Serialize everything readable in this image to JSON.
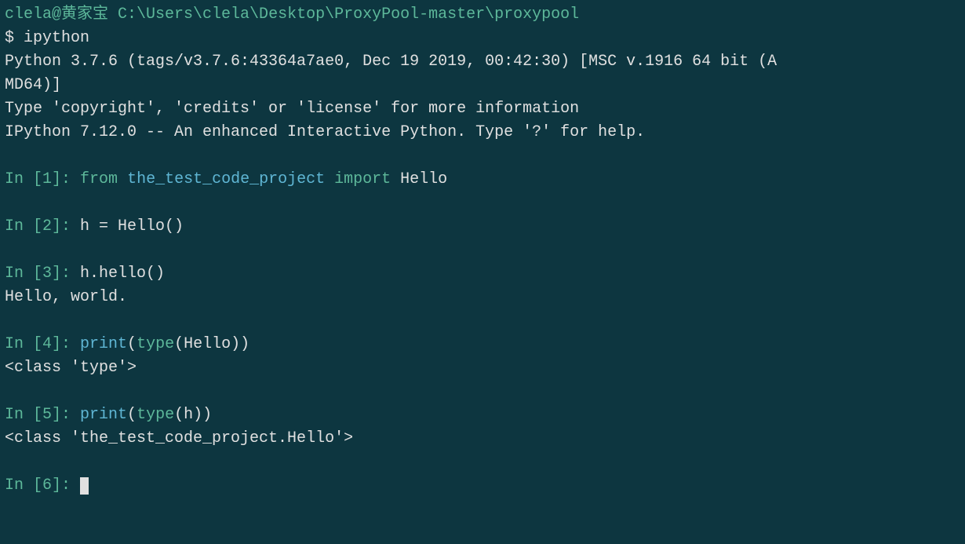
{
  "shell": {
    "user_host": "clela@黄家宝",
    "path": "C:\\Users\\clela\\Desktop\\ProxyPool-master\\proxypool",
    "prompt_symbol": "$",
    "command": "ipython"
  },
  "startup": {
    "line1a": "Python 3.7.6 (tags/v3.7.6:43364a7ae0, Dec 19 2019, 00:42:30) [MSC v.1916 64 bit (A",
    "line1b": "MD64)]",
    "line2": "Type 'copyright', 'credits' or 'license' for more information",
    "line3": "IPython 7.12.0 -- An enhanced Interactive Python. Type '?' for help."
  },
  "cells": {
    "c1": {
      "prompt": "In [1]:",
      "kw_from": "from",
      "module": "the_test_code_project",
      "kw_import": "import",
      "name": "Hello"
    },
    "c2": {
      "prompt": "In [2]:",
      "code": "h = Hello()"
    },
    "c3": {
      "prompt": "In [3]:",
      "code": "h.hello()",
      "output": "Hello, world."
    },
    "c4": {
      "prompt": "In [4]:",
      "func": "print",
      "lparen": "(",
      "builtin": "type",
      "lparen2": "(",
      "arg": "Hello",
      "rparen2": ")",
      "rparen": ")",
      "output": "<class 'type'>"
    },
    "c5": {
      "prompt": "In [5]:",
      "func": "print",
      "lparen": "(",
      "builtin": "type",
      "lparen2": "(",
      "arg": "h",
      "rparen2": ")",
      "rparen": ")",
      "output": "<class 'the_test_code_project.Hello'>"
    },
    "c6": {
      "prompt": "In [6]:"
    }
  }
}
